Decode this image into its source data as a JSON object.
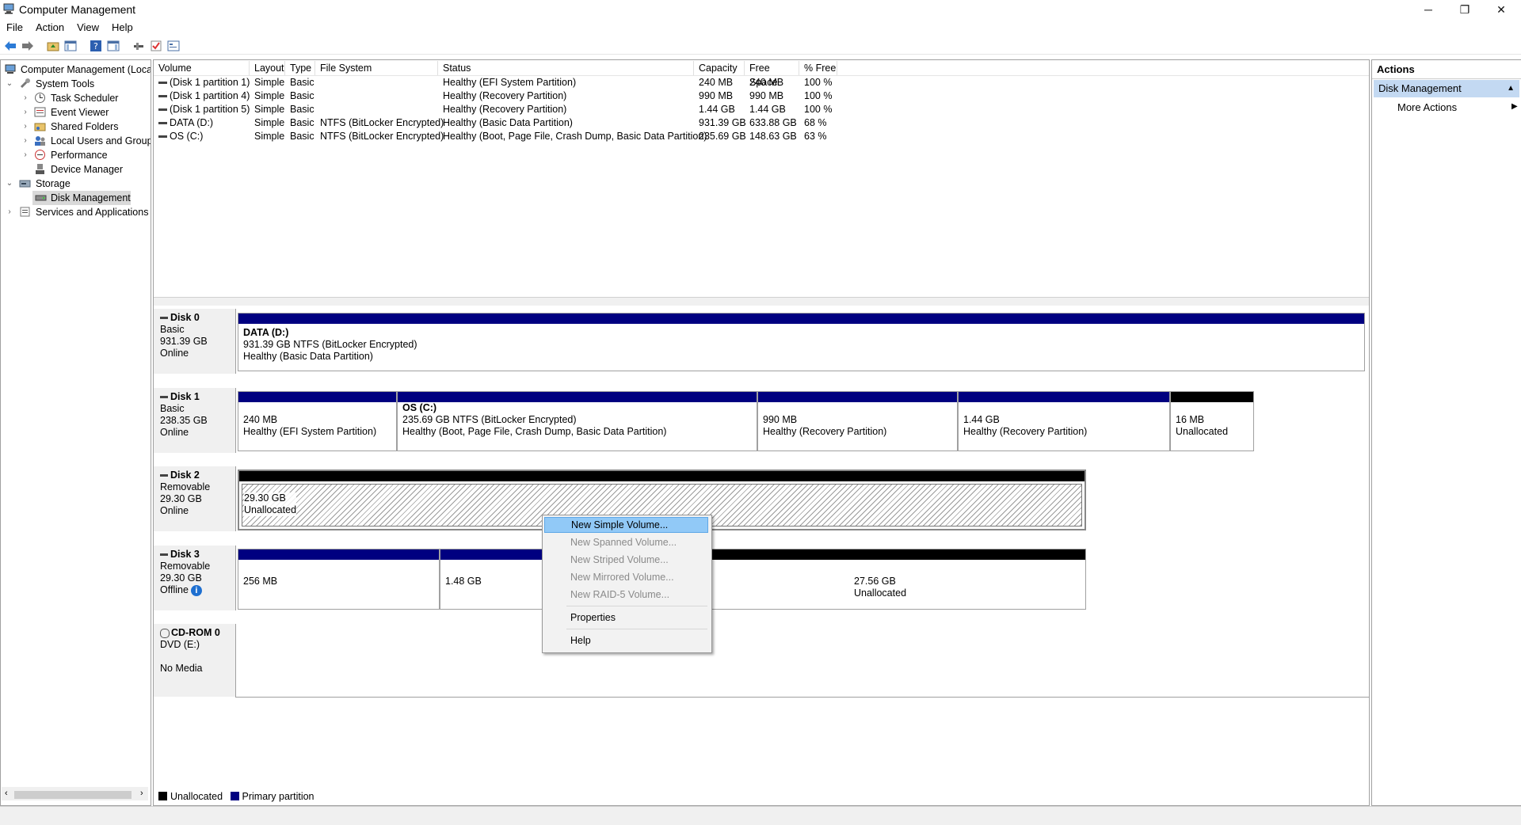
{
  "window": {
    "title": "Computer Management",
    "controls": {
      "minimize": "─",
      "restore": "❐",
      "close": "✕"
    }
  },
  "menu": [
    "File",
    "Action",
    "View",
    "Help"
  ],
  "toolbar": {
    "icons": [
      "back-arrow-icon",
      "forward-arrow-icon",
      "up-folder-icon",
      "show-hide-tree-icon",
      "help-icon",
      "show-hide-action-pane-icon",
      "connect-icon",
      "check-icon",
      "properties-icon"
    ]
  },
  "tree": {
    "root": "Computer Management (Local",
    "system_tools": "System Tools",
    "task_scheduler": "Task Scheduler",
    "event_viewer": "Event Viewer",
    "shared_folders": "Shared Folders",
    "local_users": "Local Users and Groups",
    "performance": "Performance",
    "device_manager": "Device Manager",
    "storage": "Storage",
    "disk_management": "Disk Management",
    "services": "Services and Applications"
  },
  "volumes": {
    "headers": [
      "Volume",
      "Layout",
      "Type",
      "File System",
      "Status",
      "Capacity",
      "Free Space",
      "% Free"
    ],
    "rows": [
      [
        "(Disk 1 partition 1)",
        "Simple",
        "Basic",
        "",
        "Healthy (EFI System Partition)",
        "240 MB",
        "240 MB",
        "100 %"
      ],
      [
        "(Disk 1 partition 4)",
        "Simple",
        "Basic",
        "",
        "Healthy (Recovery Partition)",
        "990 MB",
        "990 MB",
        "100 %"
      ],
      [
        "(Disk 1 partition 5)",
        "Simple",
        "Basic",
        "",
        "Healthy (Recovery Partition)",
        "1.44 GB",
        "1.44 GB",
        "100 %"
      ],
      [
        "DATA (D:)",
        "Simple",
        "Basic",
        "NTFS (BitLocker Encrypted)",
        "Healthy (Basic Data Partition)",
        "931.39 GB",
        "633.88 GB",
        "68 %"
      ],
      [
        "OS (C:)",
        "Simple",
        "Basic",
        "NTFS (BitLocker Encrypted)",
        "Healthy (Boot, Page File, Crash Dump, Basic Data Partition)",
        "235.69 GB",
        "148.63 GB",
        "63 %"
      ]
    ]
  },
  "disks": {
    "d0": {
      "name": "Disk 0",
      "type": "Basic",
      "size": "931.39 GB",
      "status": "Online",
      "p1": {
        "title": "DATA  (D:)",
        "line1": "931.39 GB NTFS (BitLocker Encrypted)",
        "line2": "Healthy (Basic Data Partition)"
      }
    },
    "d1": {
      "name": "Disk 1",
      "type": "Basic",
      "size": "238.35 GB",
      "status": "Online",
      "p1": {
        "line1": "240 MB",
        "line2": "Healthy (EFI System Partition)"
      },
      "p2": {
        "title": "OS  (C:)",
        "line1": "235.69 GB NTFS (BitLocker Encrypted)",
        "line2": "Healthy (Boot, Page File, Crash Dump, Basic Data Partition)"
      },
      "p3": {
        "line1": "990 MB",
        "line2": "Healthy (Recovery Partition)"
      },
      "p4": {
        "line1": "1.44 GB",
        "line2": "Healthy (Recovery Partition)"
      },
      "p5": {
        "line1": "16 MB",
        "line2": "Unallocated"
      }
    },
    "d2": {
      "name": "Disk 2",
      "type": "Removable",
      "size": "29.30 GB",
      "status": "Online",
      "p1": {
        "line1": "29.30 GB",
        "line2": "Unallocated"
      }
    },
    "d3": {
      "name": "Disk 3",
      "type": "Removable",
      "size": "29.30 GB",
      "status": "Offline",
      "p1": {
        "line1": "256 MB"
      },
      "p2": {
        "line1": "1.48 GB"
      },
      "p3": {
        "line1": "27.56 GB",
        "line2": "Unallocated"
      }
    },
    "cd": {
      "name": "CD-ROM 0",
      "type": "DVD (E:)",
      "status": "No Media"
    }
  },
  "legend": {
    "unallocated": "Unallocated",
    "primary": "Primary partition"
  },
  "actions": {
    "title": "Actions",
    "section": "Disk Management",
    "more": "More Actions"
  },
  "context_menu": {
    "new_simple": "New Simple Volume...",
    "new_spanned": "New Spanned Volume...",
    "new_striped": "New Striped Volume...",
    "new_mirrored": "New Mirrored Volume...",
    "new_raid5": "New RAID-5 Volume...",
    "properties": "Properties",
    "help": "Help"
  },
  "colors": {
    "primary_partition": "#000080",
    "unallocated": "#000000",
    "highlight": "#91c9f7",
    "actions_header": "#c3d9f2"
  }
}
